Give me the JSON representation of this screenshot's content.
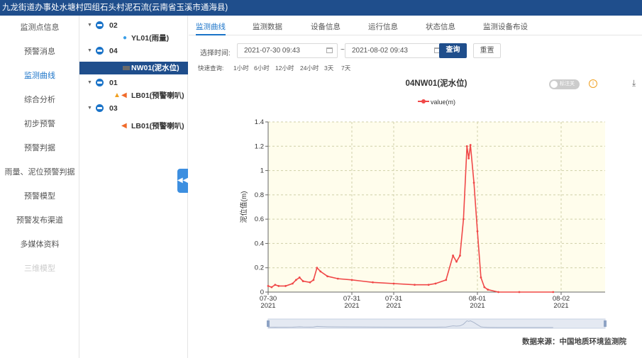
{
  "header": {
    "title": "九龙街道办事处水塘村四组石头村泥石流(云南省玉溪市通海县)"
  },
  "nav": {
    "items": [
      {
        "label": "监测点信息",
        "state": "normal"
      },
      {
        "label": "预警消息",
        "state": "normal"
      },
      {
        "label": "监测曲线",
        "state": "active"
      },
      {
        "label": "综合分析",
        "state": "normal"
      },
      {
        "label": "初步预警",
        "state": "normal"
      },
      {
        "label": "预警判据",
        "state": "normal"
      },
      {
        "label": "雨量、泥位预警判据",
        "state": "normal"
      },
      {
        "label": "预警模型",
        "state": "normal"
      },
      {
        "label": "预警发布渠道",
        "state": "normal"
      },
      {
        "label": "多媒体资料",
        "state": "normal"
      },
      {
        "label": "三维模型",
        "state": "disabled"
      }
    ]
  },
  "tree": {
    "collapse_icon": "double-chevron-left-icon",
    "rows": [
      {
        "type": "group",
        "label": "02",
        "icon": "database-icon"
      },
      {
        "type": "leaf",
        "label": "YL01(雨量)",
        "icon": "raindrop-icon"
      },
      {
        "type": "group",
        "label": "04",
        "icon": "database-icon"
      },
      {
        "type": "leaf",
        "label": "NW01(泥水位)",
        "icon": "level-gauge-icon",
        "selected": true
      },
      {
        "type": "group",
        "label": "01",
        "icon": "database-icon"
      },
      {
        "type": "leaf",
        "label": "LB01(预警喇叭)",
        "icon": "speaker-icon",
        "warning": true
      },
      {
        "type": "group",
        "label": "03",
        "icon": "database-icon"
      },
      {
        "type": "leaf",
        "label": "LB01(预警喇叭)",
        "icon": "speaker-icon"
      }
    ]
  },
  "tabs": [
    {
      "label": "监测曲线",
      "active": true
    },
    {
      "label": "监测数据"
    },
    {
      "label": "设备信息"
    },
    {
      "label": "运行信息"
    },
    {
      "label": "状态信息"
    },
    {
      "label": "监测设备布设"
    }
  ],
  "filters": {
    "time_label": "选择时间:",
    "start": "2021-07-30 09:43",
    "separator": "~",
    "end": "2021-08-02 09:43",
    "query_button": "查询",
    "reset_button": "重置",
    "quick_label": "快速查询:",
    "quick_options": [
      "1小时",
      "6小时",
      "12小时",
      "24小时",
      "3天",
      "7天"
    ]
  },
  "toolbar": {
    "toggle_label": "标注关"
  },
  "footer": {
    "source": "数据来源：中国地质环境监测院"
  },
  "colors": {
    "accent": "#1a73c8",
    "header_bg": "#1f4e8c",
    "series": "#f04848",
    "plot_bg": "#fffdec"
  },
  "chart_data": {
    "type": "line",
    "title": "04NW01(泥水位)",
    "ylabel": "泥位值(m)",
    "legend": "top-center",
    "ylim": [
      0,
      1.4
    ],
    "yticks": [
      0,
      0.2,
      0.4,
      0.6,
      0.8,
      1,
      1.2,
      1.4
    ],
    "xlim": [
      "2021-07-30 00:00",
      "2021-08-02 00:00"
    ],
    "xticks": [
      {
        "t": "2021-07-30 00:00",
        "label": [
          "07-30",
          "2021"
        ]
      },
      {
        "t": "2021-07-31 00:00",
        "label": [
          "07-31",
          "2021"
        ]
      },
      {
        "t": "2021-07-31 12:00",
        "label": [
          "07-31",
          "2021"
        ]
      },
      {
        "t": "2021-08-01 12:00",
        "label": [
          "08-01",
          "2021"
        ]
      },
      {
        "t": "2021-08-02 12:00",
        "label": [
          "08-02",
          "2021"
        ]
      }
    ],
    "series": [
      {
        "name": "value(m)",
        "points": [
          [
            "2021-07-30 00:00",
            0.05
          ],
          [
            "2021-07-30 01:00",
            0.04
          ],
          [
            "2021-07-30 02:00",
            0.06
          ],
          [
            "2021-07-30 03:00",
            0.05
          ],
          [
            "2021-07-30 05:00",
            0.05
          ],
          [
            "2021-07-30 07:00",
            0.07
          ],
          [
            "2021-07-30 08:00",
            0.1
          ],
          [
            "2021-07-30 09:00",
            0.12
          ],
          [
            "2021-07-30 10:00",
            0.09
          ],
          [
            "2021-07-30 12:00",
            0.08
          ],
          [
            "2021-07-30 13:00",
            0.1
          ],
          [
            "2021-07-30 14:00",
            0.2
          ],
          [
            "2021-07-30 15:00",
            0.17
          ],
          [
            "2021-07-30 17:00",
            0.13
          ],
          [
            "2021-07-30 20:00",
            0.11
          ],
          [
            "2021-07-31 00:00",
            0.1
          ],
          [
            "2021-07-31 06:00",
            0.08
          ],
          [
            "2021-07-31 12:00",
            0.07
          ],
          [
            "2021-07-31 18:00",
            0.06
          ],
          [
            "2021-07-31 22:00",
            0.06
          ],
          [
            "2021-08-01 00:00",
            0.07
          ],
          [
            "2021-08-01 03:00",
            0.1
          ],
          [
            "2021-08-01 05:00",
            0.3
          ],
          [
            "2021-08-01 06:00",
            0.25
          ],
          [
            "2021-08-01 07:00",
            0.3
          ],
          [
            "2021-08-01 08:00",
            0.6
          ],
          [
            "2021-08-01 09:00",
            1.2
          ],
          [
            "2021-08-01 09:30",
            1.1
          ],
          [
            "2021-08-01 10:00",
            1.21
          ],
          [
            "2021-08-01 11:00",
            0.9
          ],
          [
            "2021-08-01 12:00",
            0.5
          ],
          [
            "2021-08-01 13:00",
            0.12
          ],
          [
            "2021-08-01 14:00",
            0.04
          ],
          [
            "2021-08-01 15:00",
            0.02
          ],
          [
            "2021-08-01 18:00",
            0.0
          ],
          [
            "2021-08-02 00:00",
            0.0
          ],
          [
            "2021-08-02 09:43",
            0.0
          ]
        ]
      }
    ]
  }
}
